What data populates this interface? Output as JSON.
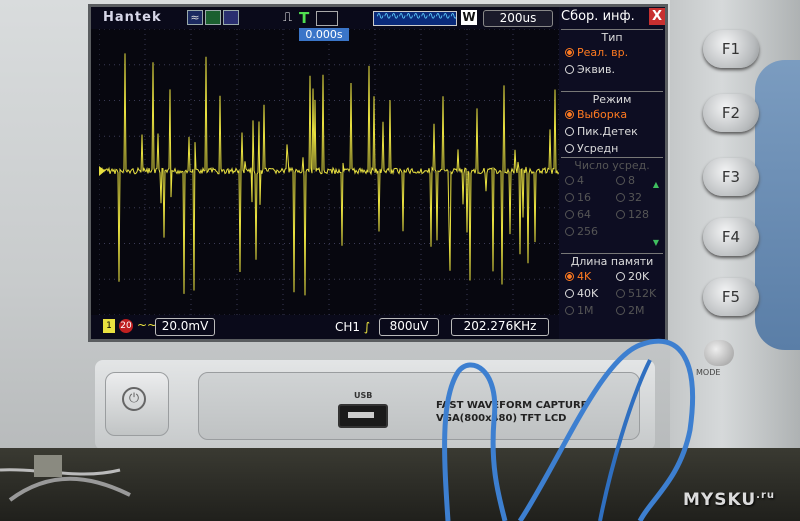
{
  "scope": {
    "brand": "Hantek",
    "timebase": "200us",
    "trigger_position": "0.000s",
    "memory_badge": "W",
    "channel": {
      "marker": "1",
      "bandwidth_badge": "20",
      "coupling": "~~",
      "volts_div": "20.0mV"
    },
    "trigger": {
      "source": "CH1",
      "edge_symbol": "∫",
      "level": "800uV"
    },
    "frequency": "202.276KHz"
  },
  "menu": {
    "title": "Сбор. инф.",
    "close": "X",
    "type_section": {
      "heading": "Тип",
      "options": [
        {
          "label": "Реал. вр.",
          "selected": true
        },
        {
          "label": "Эквив.",
          "selected": false
        }
      ]
    },
    "mode_section": {
      "heading": "Режим",
      "options": [
        {
          "label": "Выборка",
          "selected": true
        },
        {
          "label": "Пик.Детек",
          "selected": false
        },
        {
          "label": "Усредн",
          "selected": false
        }
      ]
    },
    "avg_section": {
      "heading": "Число усред.",
      "options": [
        "4",
        "8",
        "16",
        "32",
        "64",
        "128",
        "256"
      ]
    },
    "memory_section": {
      "heading": "Длина памяти",
      "options": [
        {
          "label": "4K",
          "selected": true
        },
        {
          "label": "20K",
          "selected": false
        },
        {
          "label": "40K",
          "selected": false
        },
        {
          "label": "512K",
          "selected": false
        },
        {
          "label": "1M",
          "selected": false
        },
        {
          "label": "2M",
          "selected": false
        }
      ]
    }
  },
  "keys": {
    "f1": "F1",
    "f2": "F2",
    "f3": "F3",
    "f4": "F4",
    "f5": "F5",
    "mode": "MODE"
  },
  "panel": {
    "usb_label": "USB",
    "caption_line1": "FAST WAVEFORM CAPTURE",
    "caption_line2": "VGA(800x480) TFT LCD"
  },
  "watermark": {
    "text": "MYSKU",
    "suffix": ".ru"
  },
  "colors": {
    "trace": "#e8e040",
    "selected_option": "#ff7a20",
    "trigger_bar": "#3a75c8",
    "grid": "#3a3a55"
  }
}
